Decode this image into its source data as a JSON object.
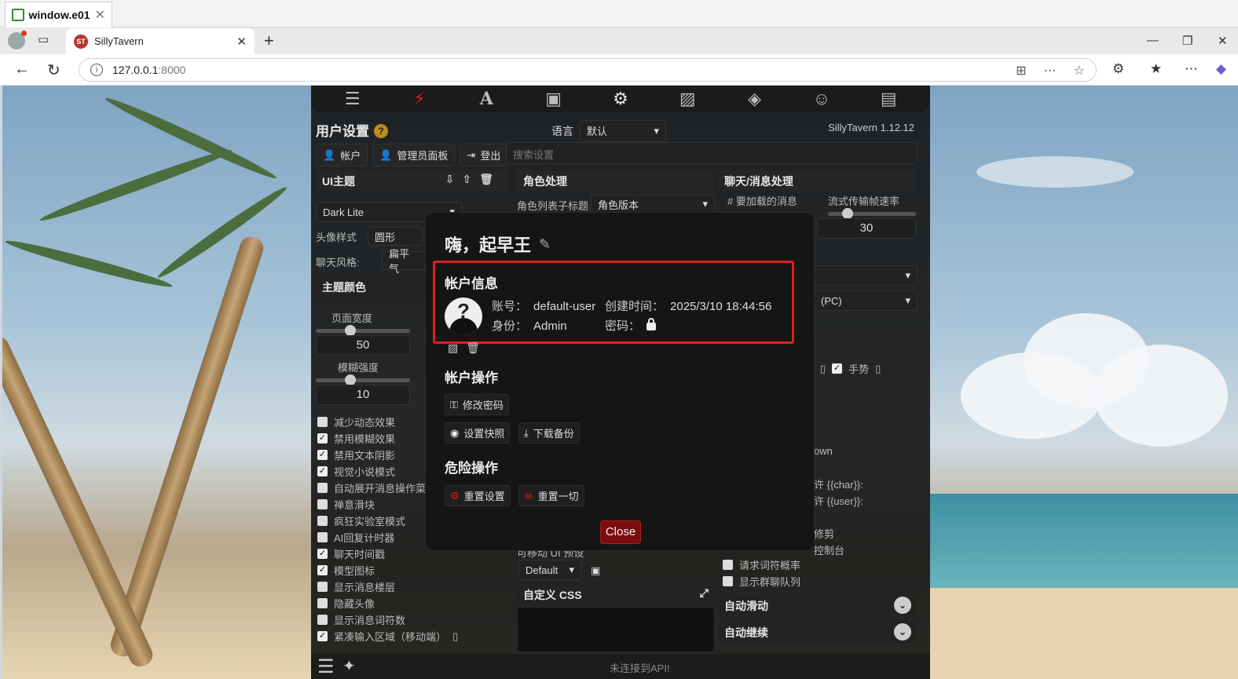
{
  "window": {
    "title": "window.e01"
  },
  "browser": {
    "tab_title": "SillyTavern",
    "tab_icon_text": "ST",
    "url_host": "127.0.0.1",
    "url_port": ":8000"
  },
  "app": {
    "title": "用户设置",
    "language_label": "语言",
    "language_value": "默认",
    "version": "SillyTavern 1.12.12",
    "account_tabs": [
      "帐户",
      "管理员面板",
      "登出"
    ],
    "search_placeholder": "搜索设置",
    "columns": [
      "UI主题",
      "角色处理",
      "聊天/消息处理"
    ],
    "theme_value": "Dark Lite",
    "avatar_style_label": "头像样式",
    "avatar_style_value": "圆形",
    "chat_style_label": "聊天风格:",
    "chat_style_value": "扁平 气",
    "theme_colors_label": "主题颜色",
    "page_width_label": "页面宽度",
    "page_width_value": "50",
    "blur_label": "模糊强度",
    "blur_value": "10",
    "char_list_label": "角色列表子标题",
    "char_list_value": "角色版本",
    "msgs_label": "# 要加载的消息",
    "stream_label": "流式传输帧速率",
    "stream_value": "30",
    "pc_value": "(PC)",
    "gesture_label": "手势",
    "partial_own": "own",
    "allow_char": "许 {{char}}:",
    "allow_user": "许 {{user}}:",
    "trim_label": "修剪",
    "console_label": "控制台",
    "request_prob": "请求词符概率",
    "show_group": "显示群聊队列",
    "mobile_ui_label": "可移动 UI 预设",
    "mobile_ui_value": "Default",
    "custom_css": "自定义 CSS",
    "auto_scroll": "自动滑动",
    "auto_continue": "自动继续",
    "api_status": "未连接到API!",
    "checkboxes": [
      {
        "label": "减少动态效果",
        "checked": false
      },
      {
        "label": "禁用模糊效果",
        "checked": true
      },
      {
        "label": "禁用文本阴影",
        "checked": true
      },
      {
        "label": "视觉小说模式",
        "checked": true
      },
      {
        "label": "自动展开消息操作菜",
        "checked": false
      },
      {
        "label": "禅意滑块",
        "checked": false
      },
      {
        "label": "疯狂实验室模式",
        "checked": false
      },
      {
        "label": "AI回复计时器",
        "checked": false
      },
      {
        "label": "聊天时间戳",
        "checked": true
      },
      {
        "label": "模型图标",
        "checked": true
      },
      {
        "label": "显示消息楼层",
        "checked": false
      },
      {
        "label": "隐藏头像",
        "checked": false
      },
      {
        "label": "显示消息词符数",
        "checked": false
      },
      {
        "label": "紧凑输入区域（移动端）",
        "checked": true
      }
    ],
    "checkbox_mark": "✓"
  },
  "modal": {
    "greeting": "嗨，起早王",
    "account_info_title": "帐户信息",
    "username_label": "账号：",
    "username_value": "default-user",
    "created_label": "创建时间：",
    "created_value": "2025/3/10 18:44:56",
    "role_label": "身份：",
    "role_value": "Admin",
    "password_label": "密码：",
    "avatar_glyph": "?",
    "actions_title": "帐户操作",
    "change_password": "修改密码",
    "snapshot": "设置快照",
    "download_backup": "下载备份",
    "danger_title": "危险操作",
    "reset_settings": "重置设置",
    "reset_everything": "重置一切",
    "close": "Close"
  }
}
